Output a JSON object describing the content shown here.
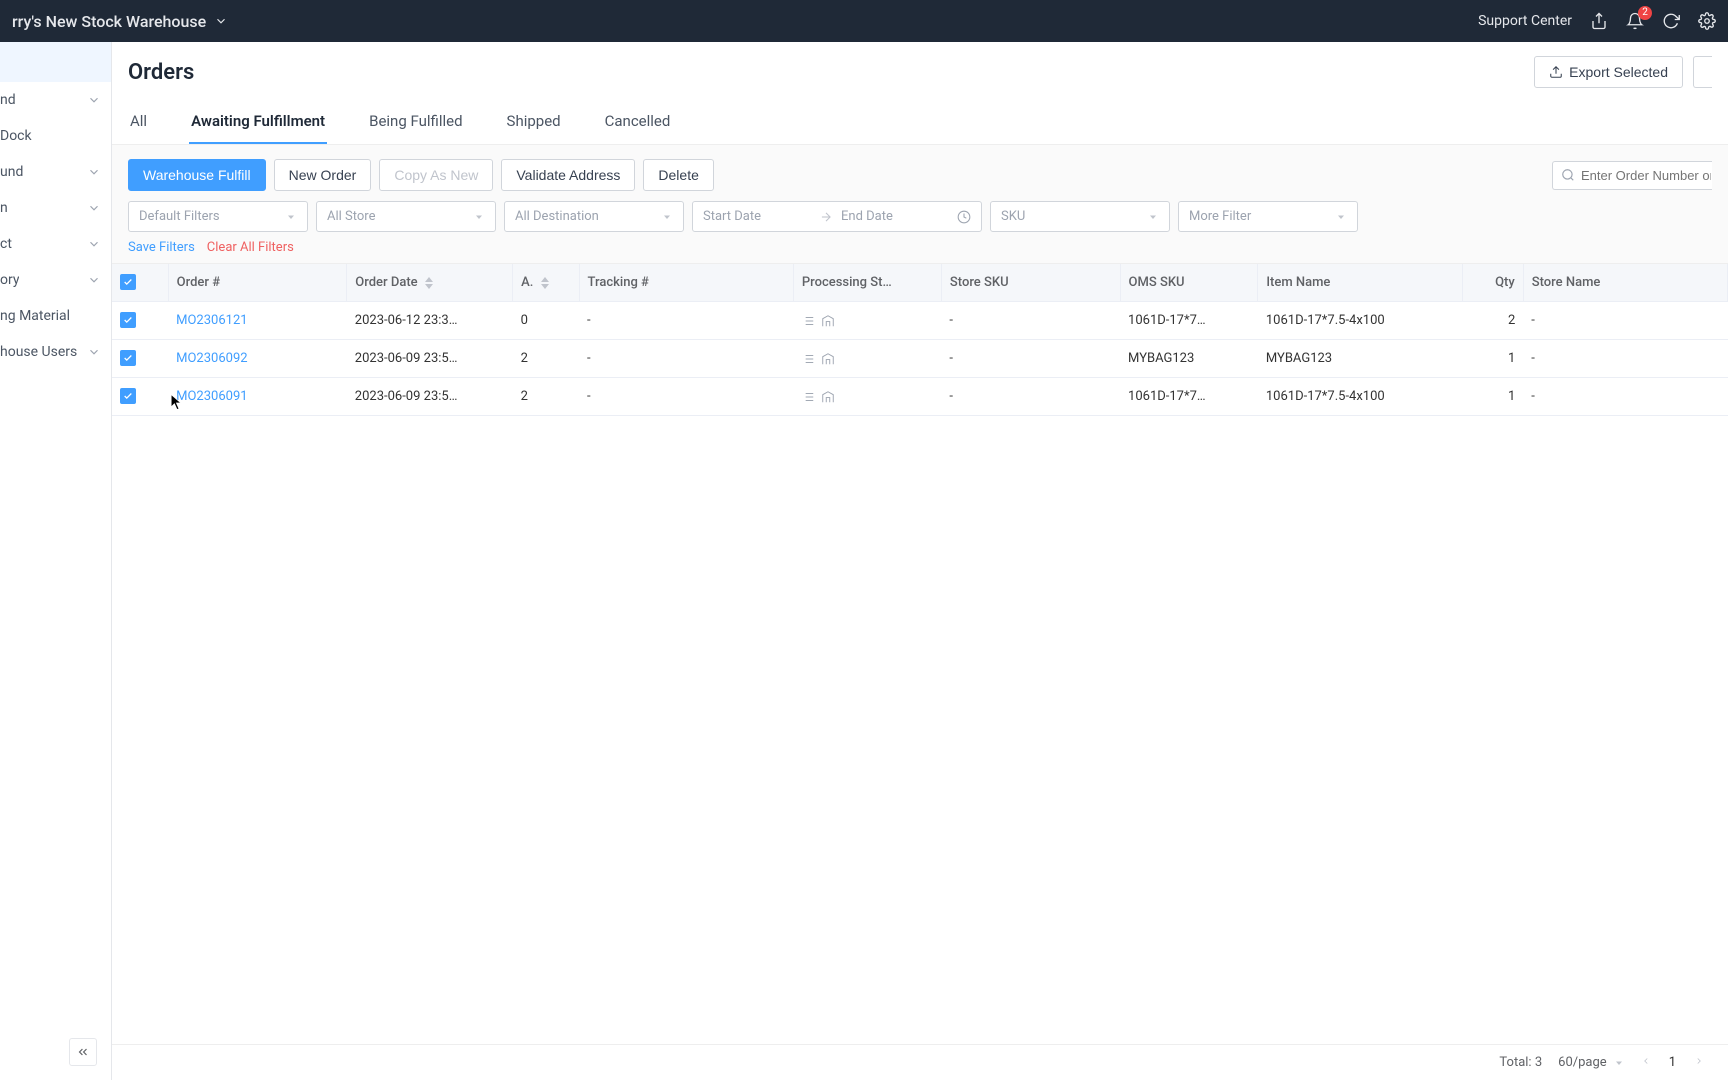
{
  "header": {
    "warehouse_name": "rry's New Stock Warehouse",
    "support_center": "Support Center",
    "notification_count": "2"
  },
  "sidebar": {
    "items": [
      {
        "label": "",
        "active": true,
        "chevron": false
      },
      {
        "label": "nd",
        "active": false,
        "chevron": true
      },
      {
        "label": "Dock",
        "active": false,
        "chevron": false
      },
      {
        "label": "und",
        "active": false,
        "chevron": true
      },
      {
        "label": "n",
        "active": false,
        "chevron": true
      },
      {
        "label": "ct",
        "active": false,
        "chevron": true
      },
      {
        "label": "ory",
        "active": false,
        "chevron": true
      },
      {
        "label": "ng Material",
        "active": false,
        "chevron": false
      },
      {
        "label": "house Users",
        "active": false,
        "chevron": true
      }
    ]
  },
  "page": {
    "title": "Orders",
    "export_button": "Export Selected"
  },
  "tabs": [
    {
      "label": "All",
      "active": false
    },
    {
      "label": "Awaiting Fulfillment",
      "active": true
    },
    {
      "label": "Being Fulfilled",
      "active": false
    },
    {
      "label": "Shipped",
      "active": false
    },
    {
      "label": "Cancelled",
      "active": false
    }
  ],
  "toolbar": {
    "warehouse_fulfill": "Warehouse Fulfill",
    "new_order": "New Order",
    "copy_as_new": "Copy As New",
    "validate_address": "Validate Address",
    "delete": "Delete",
    "search_placeholder": "Enter Order Number or S"
  },
  "filters": {
    "default_filters": "Default Filters",
    "all_store": "All Store",
    "all_destination": "All Destination",
    "start_date": "Start Date",
    "end_date": "End Date",
    "sku": "SKU",
    "more_filter": "More Filter",
    "save_filters": "Save Filters",
    "clear_all_filters": "Clear All Filters"
  },
  "table": {
    "columns": {
      "order_no": "Order #",
      "order_date": "Order Date",
      "a": "A.",
      "tracking": "Tracking #",
      "processing": "Processing St…",
      "store_sku": "Store SKU",
      "oms_sku": "OMS SKU",
      "item_name": "Item Name",
      "qty": "Qty",
      "store_name": "Store Name"
    },
    "rows": [
      {
        "order_no": "MO2306121",
        "order_date": "2023-06-12 23:3…",
        "a": "0",
        "tracking": "-",
        "store_sku": "-",
        "oms_sku": "1061D-17*7…",
        "item_name": "1061D-17*7.5-4x100",
        "qty": "2",
        "store_name": "-"
      },
      {
        "order_no": "MO2306092",
        "order_date": "2023-06-09 23:5…",
        "a": "2",
        "tracking": "-",
        "store_sku": "-",
        "oms_sku": "MYBAG123",
        "item_name": "MYBAG123",
        "qty": "1",
        "store_name": "-"
      },
      {
        "order_no": "MO2306091",
        "order_date": "2023-06-09 23:5…",
        "a": "2",
        "tracking": "-",
        "store_sku": "-",
        "oms_sku": "1061D-17*7…",
        "item_name": "1061D-17*7.5-4x100",
        "qty": "1",
        "store_name": "-"
      }
    ]
  },
  "pagination": {
    "total_label": "Total:",
    "total_value": "3",
    "page_size": "60/page",
    "current_page": "1"
  }
}
